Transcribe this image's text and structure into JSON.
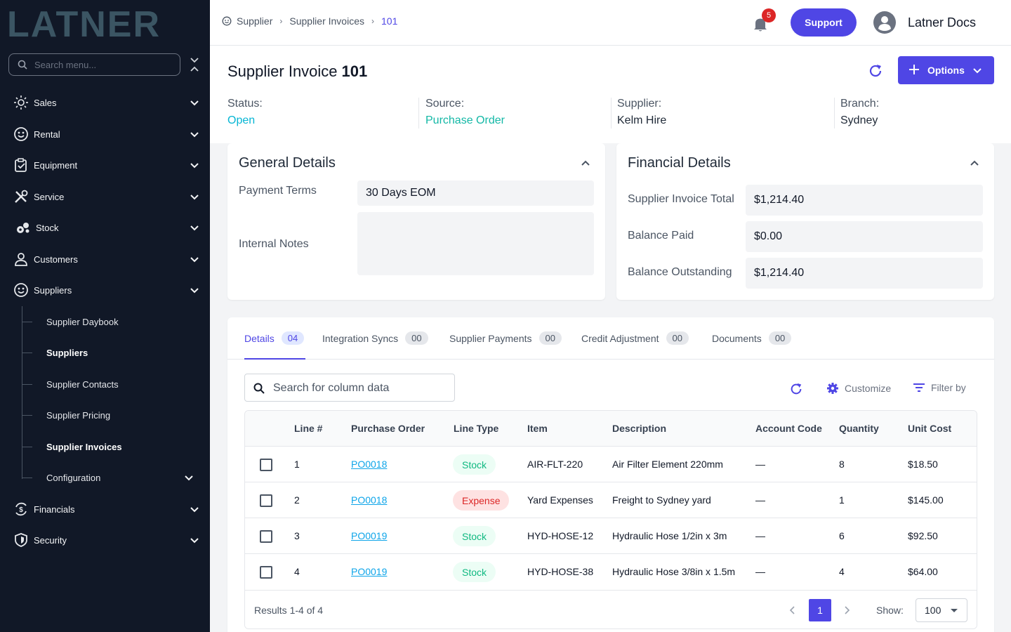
{
  "brand": {
    "logo_text": "LATNER",
    "logo_color": "#3b5563",
    "accent": "#4f46e5"
  },
  "sidebar": {
    "search_placeholder": "Search menu...",
    "items": [
      {
        "label": "Sales",
        "icon": "sun-icon"
      },
      {
        "label": "Rental",
        "icon": "smiley-icon"
      },
      {
        "label": "Equipment",
        "icon": "clipboard-check-icon"
      },
      {
        "label": "Service",
        "icon": "tools-icon"
      },
      {
        "label": "Stock",
        "icon": "boxes-icon"
      },
      {
        "label": "Customers",
        "icon": "user-icon"
      },
      {
        "label": "Suppliers",
        "icon": "smiley-icon"
      },
      {
        "label": "Financials",
        "icon": "currency-cycle-icon"
      },
      {
        "label": "Security",
        "icon": "shield-icon"
      }
    ],
    "sub_items": [
      {
        "label": "Supplier Daybook"
      },
      {
        "label": "Suppliers"
      },
      {
        "label": "Supplier Contacts"
      },
      {
        "label": "Supplier Pricing"
      },
      {
        "label": "Supplier Invoices"
      },
      {
        "label": "Configuration"
      }
    ]
  },
  "topbar": {
    "breadcrumb": [
      "Supplier",
      "Supplier Invoices",
      "101"
    ],
    "notification_count": "5",
    "support_label": "Support",
    "user_name": "Latner Docs"
  },
  "header": {
    "title": "Supplier Invoice",
    "number": "101",
    "options_label": "Options",
    "meta": [
      {
        "key": "Status:",
        "value": "Open",
        "color": "#06b6d4"
      },
      {
        "key": "Source:",
        "value": "Purchase Order",
        "color": "#14b8a6"
      },
      {
        "key": "Supplier:",
        "value": "Kelm Hire",
        "color": "#111827"
      },
      {
        "key": "Branch:",
        "value": "Sydney",
        "color": "#111827"
      }
    ]
  },
  "general": {
    "title": "General Details",
    "payment_terms_label": "Payment Terms",
    "payment_terms_value": "30 Days EOM",
    "internal_notes_label": "Internal Notes",
    "internal_notes_value": ""
  },
  "financial": {
    "title": "Financial Details",
    "rows": [
      {
        "label": "Supplier Invoice Total",
        "value": "$1,214.40"
      },
      {
        "label": "Balance Paid",
        "value": "$0.00"
      },
      {
        "label": "Balance Outstanding",
        "value": "$1,214.40"
      }
    ]
  },
  "tabs": [
    {
      "label": "Details",
      "count": "04"
    },
    {
      "label": "Integration Syncs",
      "count": "00"
    },
    {
      "label": "Supplier Payments",
      "count": "00"
    },
    {
      "label": "Credit Adjustment",
      "count": "00"
    },
    {
      "label": "Documents",
      "count": "00"
    }
  ],
  "table": {
    "search_placeholder": "Search for column data",
    "customize_label": "Customize",
    "filter_label": "Filter by",
    "columns": [
      "Line #",
      "Purchase Order",
      "Line Type",
      "Item",
      "Description",
      "Account Code",
      "Quantity",
      "Unit Cost"
    ],
    "rows": [
      {
        "line": "1",
        "po": "PO0018",
        "type": "Stock",
        "item": "AIR-FLT-220",
        "desc": "Air Filter Element 220mm",
        "account": "—",
        "qty": "8",
        "cost": "$18.50"
      },
      {
        "line": "2",
        "po": "PO0018",
        "type": "Expense",
        "item": "Yard Expenses",
        "desc": "Freight to Sydney yard",
        "account": "—",
        "qty": "1",
        "cost": "$145.00"
      },
      {
        "line": "3",
        "po": "PO0019",
        "type": "Stock",
        "item": "HYD-HOSE-12",
        "desc": "Hydraulic Hose 1/2in x 3m",
        "account": "—",
        "qty": "6",
        "cost": "$92.50"
      },
      {
        "line": "4",
        "po": "PO0019",
        "type": "Stock",
        "item": "HYD-HOSE-38",
        "desc": "Hydraulic Hose 3/8in x 1.5m",
        "account": "—",
        "qty": "4",
        "cost": "$64.00"
      }
    ],
    "results_text": "Results 1-4 of 4",
    "current_page": "1",
    "show_label": "Show:",
    "page_size": "100"
  }
}
